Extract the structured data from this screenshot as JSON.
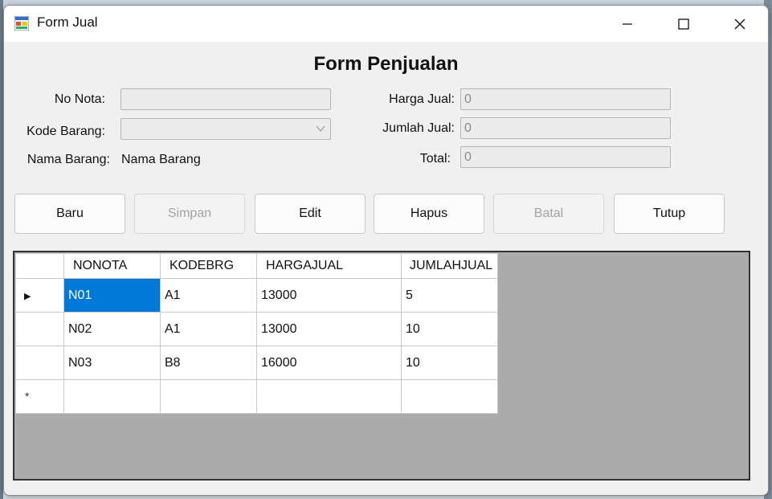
{
  "window": {
    "title": "Form Jual"
  },
  "form": {
    "heading": "Form Penjualan",
    "no_nota_label": "No Nota:",
    "no_nota_value": "",
    "kode_barang_label": "Kode Barang:",
    "kode_barang_value": "",
    "nama_barang_label": "Nama Barang:",
    "nama_barang_value": "Nama Barang",
    "harga_jual_label": "Harga Jual:",
    "harga_jual_value": "0",
    "jumlah_jual_label": "Jumlah Jual:",
    "jumlah_jual_value": "0",
    "total_label": "Total:",
    "total_value": "0"
  },
  "buttons": {
    "baru": "Baru",
    "simpan": "Simpan",
    "edit": "Edit",
    "hapus": "Hapus",
    "batal": "Batal",
    "tutup": "Tutup"
  },
  "grid": {
    "columns": [
      "NONOTA",
      "KODEBRG",
      "HARGAJUAL",
      "JUMLAHJUAL"
    ],
    "rows": [
      [
        "N01",
        "A1",
        "13000",
        "5"
      ],
      [
        "N02",
        "A1",
        "13000",
        "10"
      ],
      [
        "N03",
        "B8",
        "16000",
        "10"
      ]
    ],
    "current_row_marker": "▶",
    "new_row_marker": "*"
  },
  "colors": {
    "selection": "#0078d7",
    "grid_background": "#ababab"
  }
}
